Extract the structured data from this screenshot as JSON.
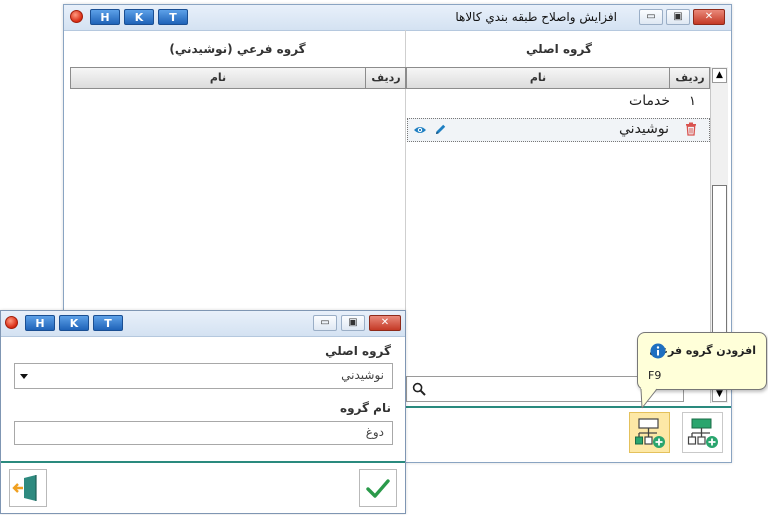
{
  "main_window": {
    "title": "افزايش واصلاح طبقه بندي كالاها",
    "hkt": [
      "H",
      "K",
      "T"
    ],
    "controls": {
      "minimize": "▭",
      "maximize": "▣",
      "close": "✕"
    },
    "main_group": {
      "header": "گروه اصلي",
      "columns": {
        "row": "رديف",
        "name": "نام"
      },
      "rows": [
        {
          "num": "۱",
          "name": "خدمات"
        },
        {
          "num": "",
          "name": "نوشيدني"
        }
      ]
    },
    "sub_group": {
      "header": "گروه فرعي (نوشيدني)",
      "columns": {
        "row": "رديف",
        "name": "نام"
      }
    },
    "tooltip": {
      "title": "افزودن گروه فرعي",
      "shortcut": "F9"
    },
    "colors": {
      "accent": "#2a8a7e",
      "tool_active": "#fde8a6",
      "tooltip_bg": "#ffffd9"
    }
  },
  "dialog": {
    "hkt": [
      "H",
      "K",
      "T"
    ],
    "controls": {
      "minimize": "▭",
      "maximize": "▣",
      "close": "✕"
    },
    "main_group_label": "گروه اصلي",
    "main_group_value": "نوشيدني",
    "group_name_label": "نام گروه",
    "group_name_value": "دوغ"
  }
}
